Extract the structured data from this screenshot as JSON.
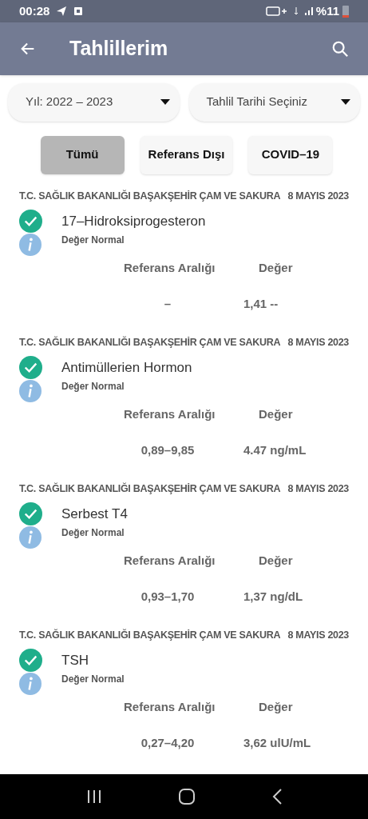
{
  "status_bar": {
    "time": "00:28",
    "battery": "%11"
  },
  "app_bar": {
    "title": "Tahlillerim"
  },
  "filters": [
    {
      "label": "Yıl: 2022 – 2023"
    },
    {
      "label": "Tahlil Tarihi Seçiniz"
    }
  ],
  "tabs": [
    {
      "label": "Tümü",
      "selected": true
    },
    {
      "label": "Referans Dışı",
      "selected": false
    },
    {
      "label": "COVID–19",
      "selected": false
    }
  ],
  "results": [
    {
      "hospital": "T.C. SAĞLIK BAKANLIĞI BAŞAKŞEHİR ÇAM VE SAKURA",
      "date": "8 MAYIS 2023",
      "name": "17–Hidroksiprogesteron",
      "status": "Değer Normal",
      "range_label": "Referans Aralığı",
      "value_label": "Değer",
      "range": "–",
      "value": "1,41 --"
    },
    {
      "hospital": "T.C. SAĞLIK BAKANLIĞI BAŞAKŞEHİR ÇAM VE SAKURA",
      "date": "8 MAYIS 2023",
      "name": "Antimüllerien Hormon",
      "status": "Değer Normal",
      "range_label": "Referans Aralığı",
      "value_label": "Değer",
      "range": "0,89–9,85",
      "value": "4.47 ng/mL"
    },
    {
      "hospital": "T.C. SAĞLIK BAKANLIĞI BAŞAKŞEHİR ÇAM VE SAKURA",
      "date": "8 MAYIS 2023",
      "name": "Serbest T4",
      "status": "Değer Normal",
      "range_label": "Referans Aralığı",
      "value_label": "Değer",
      "range": "0,93–1,70",
      "value": "1,37 ng/dL"
    },
    {
      "hospital": "T.C. SAĞLIK BAKANLIĞI BAŞAKŞEHİR ÇAM VE SAKURA",
      "date": "8 MAYIS 2023",
      "name": "TSH",
      "status": "Değer Normal",
      "range_label": "Referans Aralığı",
      "value_label": "Değer",
      "range": "0,27–4,20",
      "value": "3,62 ulU/mL"
    }
  ]
}
